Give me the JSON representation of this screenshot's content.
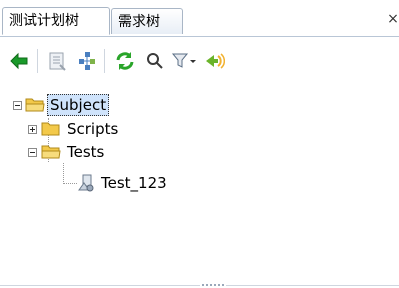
{
  "tabs": [
    {
      "label": "测试计划树",
      "active": true
    },
    {
      "label": "需求树",
      "active": false
    }
  ],
  "tab_close_glyph": "×",
  "toolbar": {
    "buttons": [
      {
        "name": "back-arrow-icon",
        "color": "#1a9a2a"
      },
      {
        "name": "details-icon",
        "color": "#9aa3ae"
      },
      {
        "name": "tree-expand-icon",
        "color": "#4a7fc0"
      },
      {
        "name": "refresh-icon",
        "color": "#2aa52a"
      },
      {
        "name": "search-icon",
        "color": "#3a3a3a"
      },
      {
        "name": "filter-icon",
        "color": "#5b6f86"
      },
      {
        "name": "go-to-icon",
        "color": "#6ab42a"
      }
    ]
  },
  "tree": {
    "root": {
      "label": "Subject",
      "expanded": true,
      "selected": true
    },
    "children": [
      {
        "label": "Scripts",
        "expanded": false,
        "type": "folder"
      },
      {
        "label": "Tests",
        "expanded": true,
        "type": "folder",
        "children": [
          {
            "label": "Test_123",
            "type": "test"
          }
        ]
      }
    ]
  },
  "colors": {
    "selection": "#cfe3fb",
    "folder": "#f3c94a",
    "folder_open": "#f7dc7c"
  }
}
